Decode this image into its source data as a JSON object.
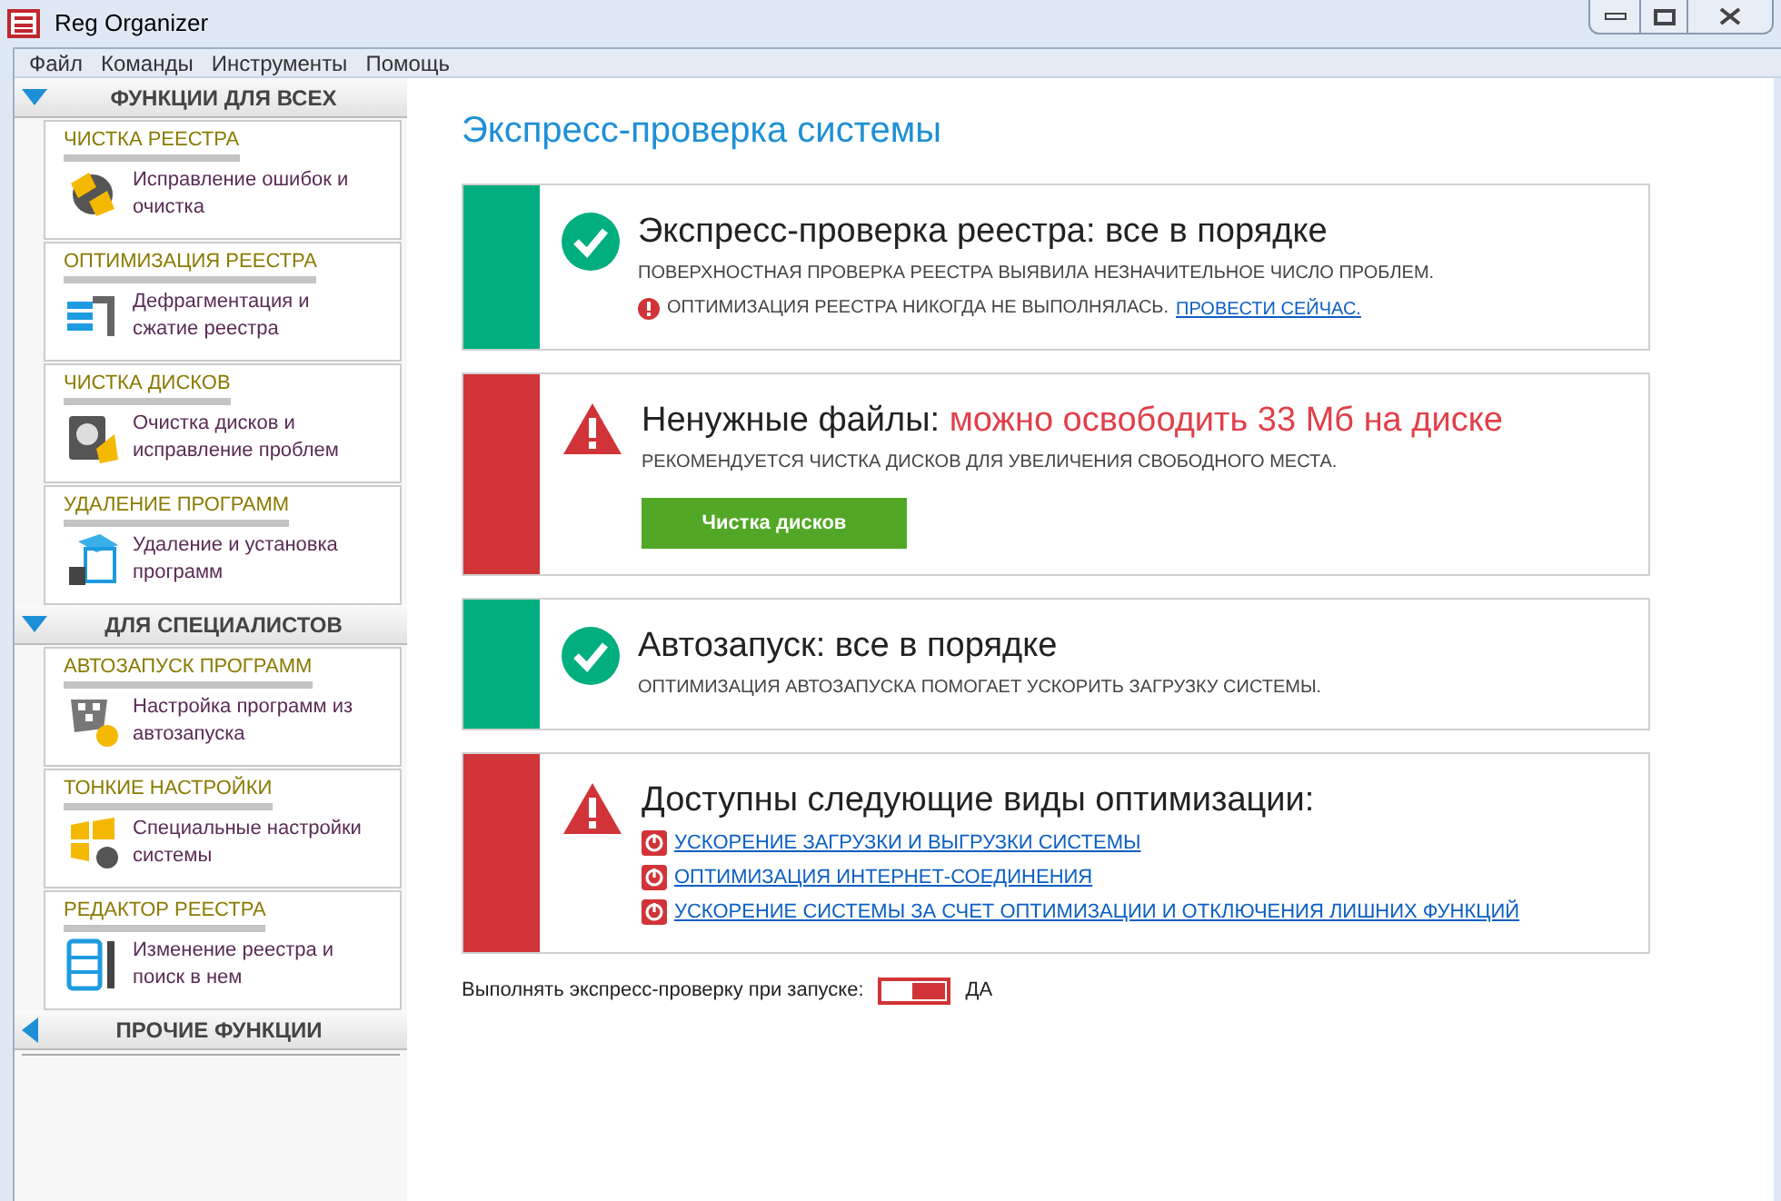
{
  "window": {
    "title": "Reg Organizer"
  },
  "menu": [
    "Файл",
    "Команды",
    "Инструменты",
    "Помощь"
  ],
  "sidebar": [
    {
      "title": "ФУНКЦИИ ДЛЯ ВСЕХ",
      "expanded": true,
      "items": [
        {
          "title": "ЧИСТКА РЕЕСТРА",
          "description": "Исправление ошибок и очистка"
        },
        {
          "title": "ОПТИМИЗАЦИЯ РЕЕСТРА",
          "description": "Дефрагментация и сжатие реестра"
        },
        {
          "title": "ЧИСТКА ДИСКОВ",
          "description": "Очистка дисков и исправление проблем"
        },
        {
          "title": "УДАЛЕНИЕ ПРОГРАММ",
          "description": "Удаление и установка программ"
        }
      ]
    },
    {
      "title": "ДЛЯ СПЕЦИАЛИСТОВ",
      "expanded": true,
      "items": [
        {
          "title": "АВТОЗАПУСК ПРОГРАММ",
          "description": "Настройка программ из автозапуска"
        },
        {
          "title": "ТОНКИЕ НАСТРОЙКИ",
          "description": "Специальные настройки системы"
        },
        {
          "title": "РЕДАКТОР РЕЕСТРА",
          "description": "Изменение реестра и поиск в нем"
        }
      ]
    },
    {
      "title": "ПРОЧИЕ ФУНКЦИИ",
      "expanded": false
    }
  ],
  "page_title": "Экспресс-проверка системы",
  "cards": [
    {
      "ok": true,
      "title": "Экспресс-проверка реестра: все в порядке",
      "lines": [
        {
          "kind": "text",
          "text": "ПОВЕРХНОСТНАЯ ПРОВЕРКА РЕЕСТРА ВЫЯВИЛА НЕЗНАЧИТЕЛЬНОЕ ЧИСЛО ПРОБЛЕМ."
        },
        {
          "kind": "alert",
          "text": "ОПТИМИЗАЦИЯ РЕЕСТРА НИКОГДА НЕ ВЫПОЛНЯЛАСЬ.",
          "link": "ПРОВЕСТИ СЕЙЧАС."
        }
      ]
    },
    {
      "ok": false,
      "title": "Ненужные файлы:",
      "highlight": "можно освободить 33 Мб на диске",
      "lines": [
        {
          "kind": "text",
          "text": "РЕКОМЕНДУЕТСЯ ЧИСТКА ДИСКОВ ДЛЯ УВЕЛИЧЕНИЯ СВОБОДНОГО МЕСТА."
        }
      ],
      "button": "Чистка дисков"
    },
    {
      "ok": true,
      "title": "Автозапуск: все в порядке",
      "lines": [
        {
          "kind": "text",
          "text": "ОПТИМИЗАЦИЯ АВТОЗАПУСКА ПОМОГАЕТ УСКОРИТЬ ЗАГРУЗКУ СИСТЕМЫ."
        }
      ]
    },
    {
      "ok": false,
      "title": "Доступны следующие виды оптимизации:",
      "lines": [
        {
          "kind": "option",
          "link": "УСКОРЕНИЕ ЗАГРУЗКИ И ВЫГРУЗКИ СИСТЕМЫ"
        },
        {
          "kind": "option",
          "link": "ОПТИМИЗАЦИЯ ИНТЕРНЕТ-СОЕДИНЕНИЯ"
        },
        {
          "kind": "option",
          "link": "УСКОРЕНИЕ СИСТЕМЫ ЗА СЧЕТ ОПТИМИЗАЦИИ И ОТКЛЮЧЕНИЯ ЛИШНИХ ФУНКЦИЙ"
        }
      ]
    }
  ],
  "startup_check": {
    "label": "Выполнять экспресс-проверку при запуске:",
    "on": true,
    "value": "ДА"
  }
}
